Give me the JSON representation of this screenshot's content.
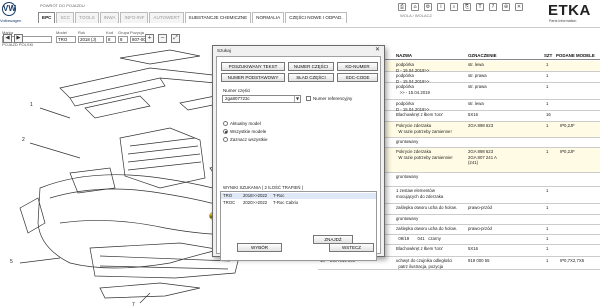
{
  "header": {
    "logo_text": "VW",
    "logo_label": "Volkswagen",
    "top_link": "POWRÓT DO POJAZDU",
    "tabs": [
      "EPC",
      "SCC",
      "TOOLS",
      "INWA",
      "INFO-INF",
      "AUTOWERT",
      "SUBSTANCJE CHEMICZNE",
      "NORMALIA",
      "CZĘŚCI NOWE I ODPAD."
    ],
    "icons": [
      "print-icon",
      "vehicle-icon",
      "settings-icon",
      "info-icon",
      "search-icon",
      "attachment-icon",
      "text-icon",
      "help-icon",
      "cart-icon",
      "close-icon"
    ],
    "icon_glyphs": [
      "⎙",
      "⌂",
      "⚙",
      "i",
      "⌕",
      "⎘",
      "T",
      "?",
      "⊕",
      "✕"
    ],
    "sub_text": "WOLA / WOLACZ",
    "etka_title": "ETKA",
    "etka_sub": "Parts Information"
  },
  "filters": [
    {
      "label": "Marka",
      "value": "VW"
    },
    {
      "label": "Model",
      "value": "TRO"
    },
    {
      "label": "Rok",
      "value": "2018 (J)"
    },
    {
      "label": "Kod",
      "value": "8"
    },
    {
      "label": "Grupa",
      "value": "8"
    },
    {
      "label": "Pozycja",
      "value": "807-000"
    }
  ],
  "side_label": "POJAZD POLSKI",
  "table": {
    "headers": [
      "NAZWA",
      "OZNACZENIE",
      "SZT",
      "PODANE MODELE"
    ],
    "rows": [
      {
        "name": "podpórka\nD - 15.04.2019>>",
        "desc": "str. lewa",
        "qty": "1",
        "models": ""
      },
      {
        "name": "podpórka\nD - 15.04.2019>>",
        "desc": "str. prawa",
        "qty": "1",
        "models": ""
      },
      {
        "name": "podpórka\n   >> - 15.04.2019",
        "desc": "str. prawa",
        "qty": "1",
        "models": ""
      },
      {
        "name": "podpórka\nD - 15.04.2019>>",
        "desc": "str. lewa",
        "qty": "1",
        "models": ""
      },
      {
        "name": "Blachowkręt z łbem 'torx'",
        "desc": "5X16",
        "qty": "16",
        "models": ""
      },
      {
        "name": "Pokrycie zderzaka\n  W razie potrzeby zamienne!",
        "desc": "2GA 898 623",
        "qty": "1",
        "models": "IP0,2JF"
      },
      {
        "name": "gruntowany",
        "desc": "",
        "qty": "",
        "models": ""
      },
      {
        "name": "Pokrycie zderzaka\n  W razie potrzeby zamiennie!",
        "desc": "2GA 898 623\n2GA 807 241 A\n(241)",
        "qty": "1",
        "models": "IP0,2JF"
      },
      {
        "name": "gruntowany",
        "desc": "",
        "qty": "",
        "models": ""
      },
      {
        "name": "1 zestaw elementów\nmocujących do zderzaka",
        "desc": "",
        "qty": "1",
        "models": ""
      },
      {
        "name": "zaślepka otworu ucha do holow.",
        "desc": "prawo-przód",
        "qty": "1",
        "models": ""
      },
      {
        "name": "gruntowany",
        "desc": "",
        "qty": "",
        "models": ""
      },
      {
        "name": "zaślepka otworu ucha do holow.",
        "desc": "prawo-przód",
        "qty": "1",
        "models": ""
      },
      {
        "name": "  09/19       041   czarny",
        "desc": "",
        "qty": "1",
        "models": ""
      },
      {
        "name": "Blachowkręt z łbem 'torx'",
        "desc": "5X16",
        "qty": "1",
        "models": ""
      },
      {
        "name": "uchwyt do czujnika odległości\n  patrz ilustracja, pozycja",
        "desc": "919 000 55",
        "qty": "1",
        "models": "IP0,7X2,7X5"
      }
    ],
    "row_refs": [
      "",
      "",
      "",
      "",
      "",
      "",
      "",
      "",
      "",
      "",
      "",
      "",
      "",
      "",
      "17",
      "18"
    ],
    "row_parts": [
      "",
      "",
      "",
      "",
      "",
      "",
      "",
      "",
      "",
      "",
      "",
      "",
      "",
      "",
      "N  909 747 01",
      "2GA 919 000"
    ]
  },
  "dialog": {
    "title": "Szukaj",
    "close_glyph": "✕",
    "buttons_row1": [
      "POSZUKIWANY TEKST",
      "NUMER CZĘŚCI",
      "KD-NUMER"
    ],
    "buttons_row2": [
      "NUMER PODSTAWOWY",
      "SŁAD CZĘŚCI",
      "SDC-CODE"
    ],
    "part_label": "Numer części",
    "part_value": "2ga807723c",
    "ref_check_label": "Numer referencyjny",
    "radio_options": [
      "Aktualny model",
      "Wszystkie modele",
      "Zaznacz wszystkie"
    ],
    "radio_selected": 1,
    "results_header": "WYNIKI SZUKANIA  ( 2 ILOŚĆ TRAFIEŃ )",
    "results": [
      {
        "model": "TRO",
        "years": "2018>>2022",
        "name": "T-Roc"
      },
      {
        "model": "TROC",
        "years": "2020>>2022",
        "name": "T-Roc Cabrio"
      }
    ],
    "find_button": "ZNAJDŹ",
    "select_button": "WYBÓR",
    "back_button": "WSTECZ"
  }
}
